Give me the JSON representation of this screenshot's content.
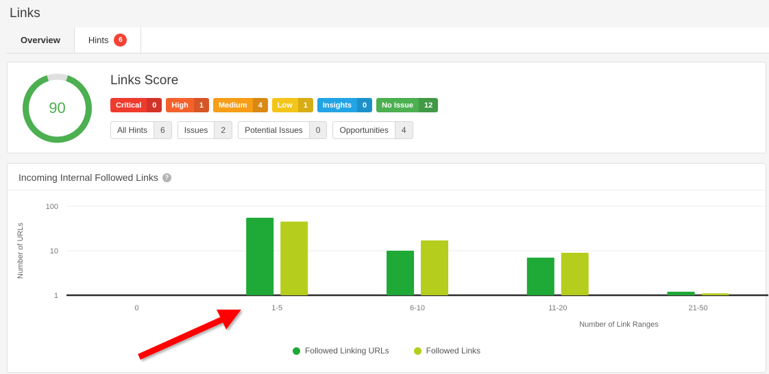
{
  "page": {
    "title": "Links"
  },
  "tabs": [
    {
      "label": "Overview",
      "active": true,
      "badge": ""
    },
    {
      "label": "Hints",
      "active": false,
      "badge": "6"
    }
  ],
  "score": {
    "title": "Links Score",
    "value": "90",
    "percent": 90,
    "ring_color": "#4caf50",
    "ring_track_color": "#e0e0e0",
    "pills": [
      {
        "label": "Critical",
        "value": "0",
        "color": "#ef3b2d"
      },
      {
        "label": "High",
        "value": "1",
        "color": "#f4622c"
      },
      {
        "label": "Medium",
        "value": "4",
        "color": "#f79d16"
      },
      {
        "label": "Low",
        "value": "1",
        "color": "#f4c519"
      },
      {
        "label": "Insights",
        "value": "0",
        "color": "#22a4e5"
      },
      {
        "label": "No Issue",
        "value": "12",
        "color": "#4caf50"
      }
    ],
    "filters": [
      {
        "label": "All Hints",
        "value": "6"
      },
      {
        "label": "Issues",
        "value": "2"
      },
      {
        "label": "Potential Issues",
        "value": "0"
      },
      {
        "label": "Opportunities",
        "value": "4"
      }
    ]
  },
  "chart_panel": {
    "title": "Incoming Internal Followed Links",
    "help_icon": "question-mark-icon",
    "help_glyph": "?"
  },
  "chart_data": {
    "type": "bar",
    "title": "Incoming Internal Followed Links",
    "xlabel": "Number of Link Ranges",
    "ylabel": "Number of URLs",
    "yscale": "log",
    "ylim": [
      1,
      100
    ],
    "yticks": [
      "1",
      "10",
      "100"
    ],
    "grid": true,
    "legend_position": "bottom",
    "categories": [
      "0",
      "1-5",
      "6-10",
      "11-20",
      "21-50"
    ],
    "series": [
      {
        "name": "Followed Linking URLs",
        "color": "#1fa937",
        "values": [
          0,
          55,
          10,
          7,
          1.2
        ]
      },
      {
        "name": "Followed Links",
        "color": "#b5ce1d",
        "values": [
          0,
          45,
          17,
          9,
          1.1
        ]
      }
    ]
  },
  "annotation": {
    "type": "arrow",
    "color": "#fe0000",
    "points_at": "1-5"
  }
}
